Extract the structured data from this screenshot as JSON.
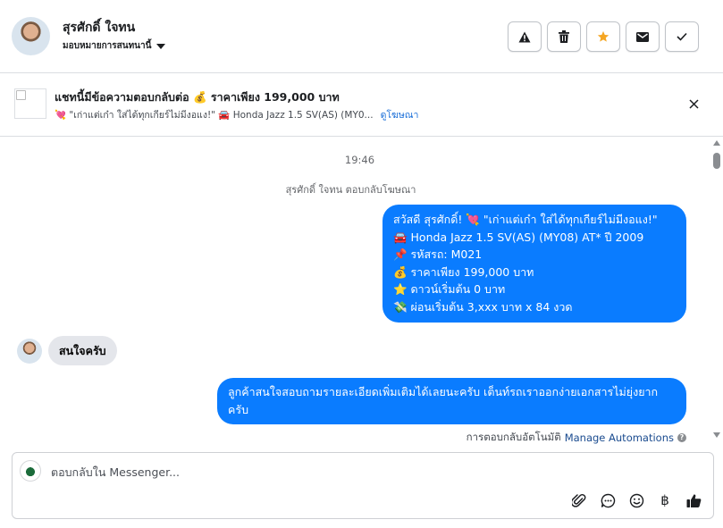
{
  "header": {
    "contact_name": "สุรศักดิ์ ใจทน",
    "assign_label": "มอบหมายการสนทนานี้",
    "actions": [
      {
        "icon": "warning-icon",
        "label": "Mark as spam"
      },
      {
        "icon": "trash-icon",
        "label": "Delete"
      },
      {
        "icon": "star-icon",
        "label": "Star",
        "color": "#f5a623"
      },
      {
        "icon": "mail-icon",
        "label": "Mark as unread"
      },
      {
        "icon": "check-icon",
        "label": "Mark as done"
      }
    ]
  },
  "ad_banner": {
    "title": "แชทนี้มีข้อความตอบกลับต่อ 💰 ราคาเพียง 199,000 บาท",
    "subtitle": "💘 \"เก่าแต่เก๋า ใส่ได้ทุกเกียร์ไม่มีงอแง!\" 🚘 Honda Jazz 1.5 SV(AS) (MY0...",
    "link_label": "ดูโฆษณา"
  },
  "thread": {
    "timestamp": "19:46",
    "replied_note": "สุรศักดิ์ ใจทน ตอบกลับโฆษณา",
    "ad_message_lines": [
      "สวัสดี สุรศักดิ์! 💘 \"เก่าแต่เก๋า ใส่ได้ทุกเกียร์ไม่มีงอแง!\"",
      "🚘 Honda Jazz 1.5 SV(AS) (MY08) AT* ปี 2009",
      "📌 รหัสรถ: M021",
      "💰 ราคาเพียง 199,000 บาท",
      "⭐ ดาวน์เริ่มต้น 0 บาท",
      "💸 ผ่อนเริ่มต้น 3,xxx บาท x 84 งวด"
    ],
    "incoming_message": "สนใจครับ",
    "reply_message": "ลูกค้าสนใจสอบถามรายละเอียดเพิ่มเติมได้เลยนะครับ เต็นท์รถเราออกง่ายเอกสารไม่ยุ่งยากครับ",
    "auto_note_prefix": "การตอบกลับอัตโนมัติ",
    "auto_note_link": "Manage Automations"
  },
  "composer": {
    "placeholder": "ตอบกลับใน Messenger...",
    "tools": [
      "attach-icon",
      "saved-reply-icon",
      "emoji-icon",
      "baht-icon",
      "like-icon"
    ],
    "baht_symbol": "฿"
  },
  "colors": {
    "outgoing_bubble": "#0a7cff",
    "incoming_bubble": "#e4e6eb",
    "link": "#1a6ed8",
    "star": "#f5a623"
  }
}
